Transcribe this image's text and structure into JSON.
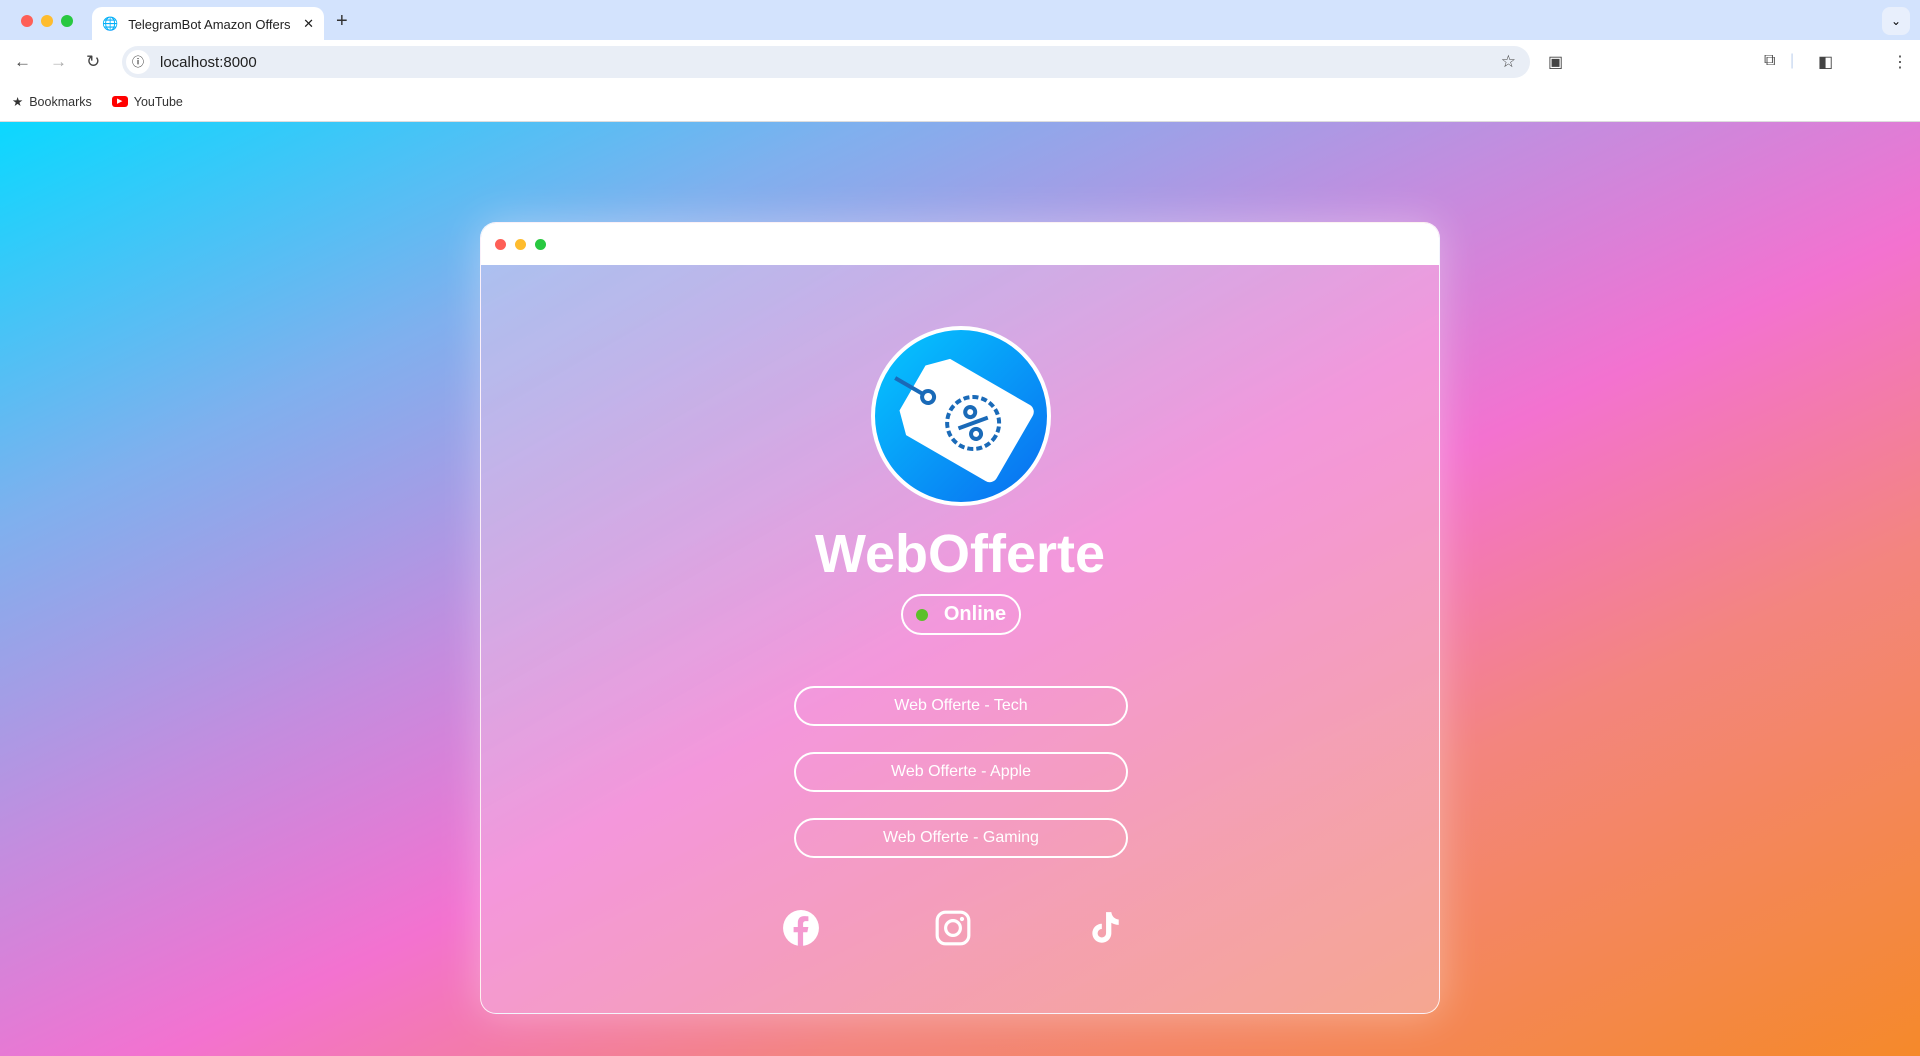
{
  "browser": {
    "tab_title": "TelegramBot Amazon Offers",
    "url": "localhost:8000",
    "bookmarks": [
      {
        "label": "Bookmarks",
        "icon": "star-icon"
      },
      {
        "label": "YouTube",
        "icon": "youtube-icon"
      }
    ]
  },
  "app": {
    "title": "WebOfferte",
    "status": "Online",
    "status_color": "#5cc02a",
    "logo_icon": "discount-tag-icon",
    "links": [
      {
        "label": "Web Offerte - Tech"
      },
      {
        "label": "Web Offerte - Apple"
      },
      {
        "label": "Web Offerte - Gaming"
      }
    ],
    "social": [
      "facebook-icon",
      "instagram-icon",
      "tiktok-icon"
    ]
  }
}
